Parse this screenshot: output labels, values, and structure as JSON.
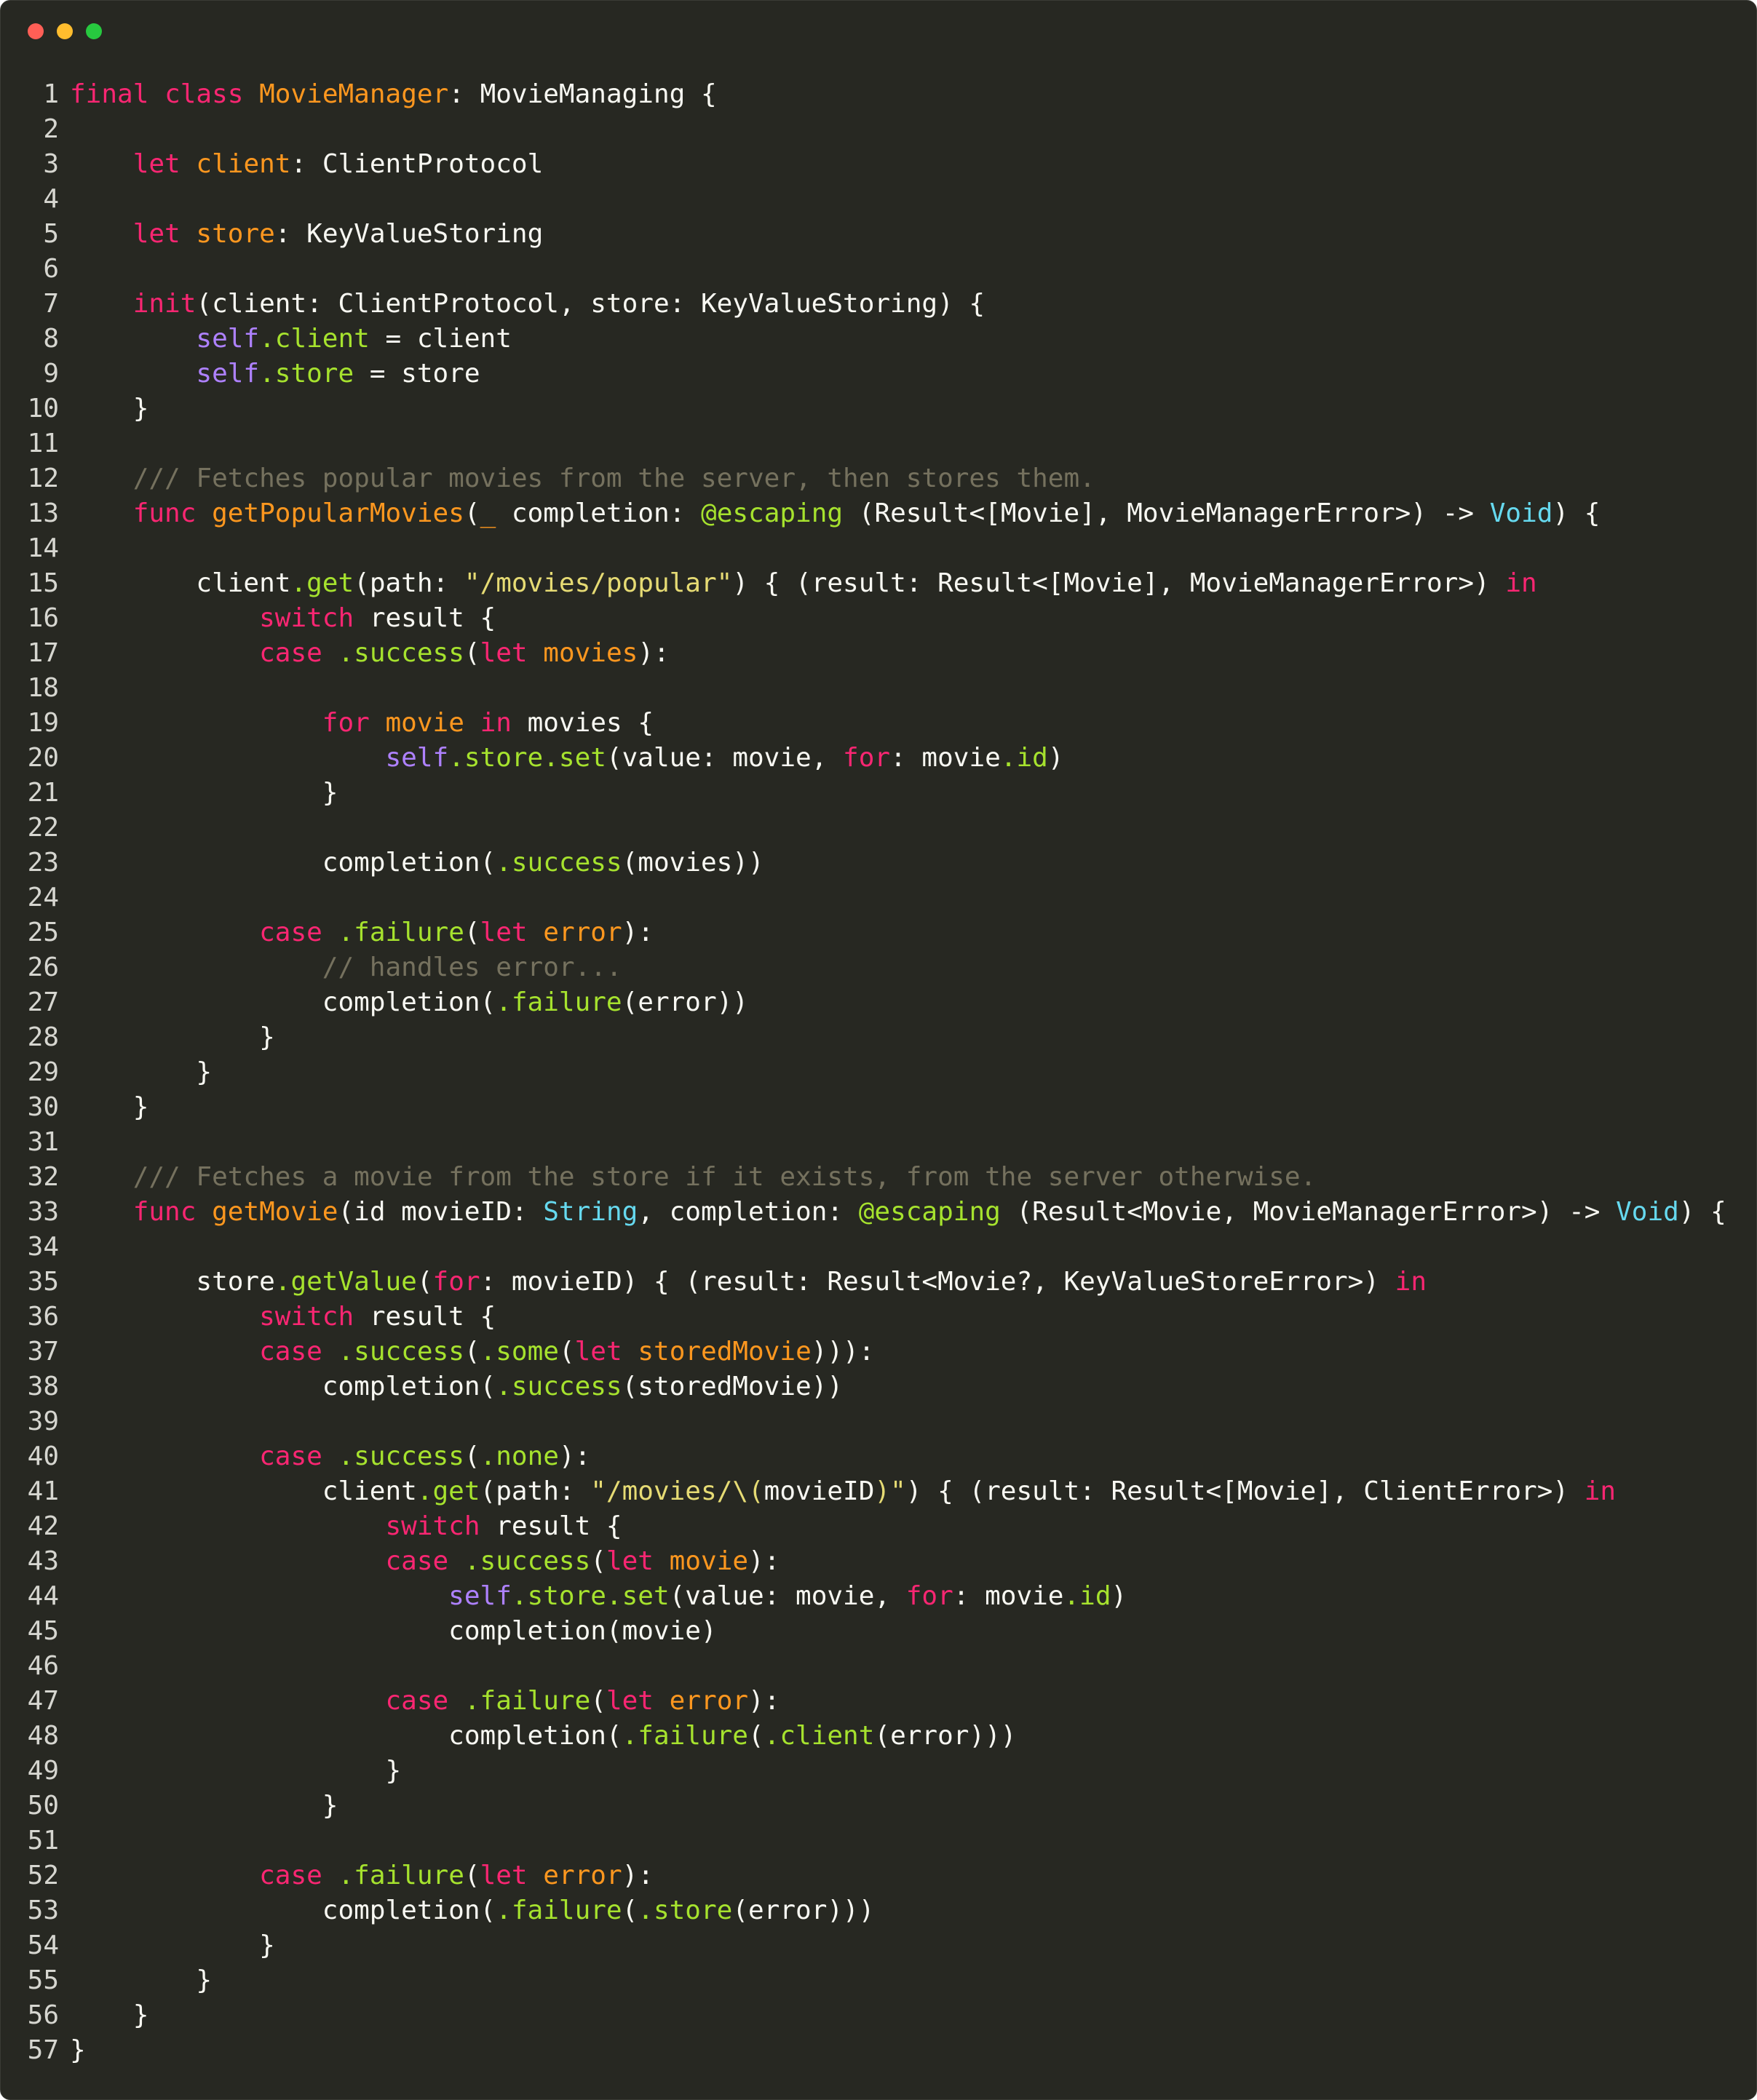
{
  "window": {
    "controls": [
      {
        "name": "close",
        "color": "#ff5f56"
      },
      {
        "name": "minimize",
        "color": "#ffbd2e"
      },
      {
        "name": "zoom",
        "color": "#27c93f"
      }
    ]
  },
  "theme": {
    "background": "#272822",
    "foreground": "#f8f8f2",
    "keyword": "#f92672",
    "declaration": "#fd971f",
    "member": "#a6e22e",
    "self": "#ae81ff",
    "type": "#66d9ef",
    "string": "#e6db74",
    "comment": "#75715e"
  },
  "code": {
    "language": "swift",
    "lines": [
      [
        [
          "k",
          "final"
        ],
        [
          "n",
          " "
        ],
        [
          "k",
          "class"
        ],
        [
          "n",
          " "
        ],
        [
          "t",
          "MovieManager"
        ],
        [
          "n",
          ": MovieManaging {"
        ]
      ],
      [],
      [
        [
          "n",
          "    "
        ],
        [
          "k",
          "let"
        ],
        [
          "n",
          " "
        ],
        [
          "t",
          "client"
        ],
        [
          "n",
          ": ClientProtocol"
        ]
      ],
      [],
      [
        [
          "n",
          "    "
        ],
        [
          "k",
          "let"
        ],
        [
          "n",
          " "
        ],
        [
          "t",
          "store"
        ],
        [
          "n",
          ": KeyValueStoring"
        ]
      ],
      [],
      [
        [
          "n",
          "    "
        ],
        [
          "k",
          "init"
        ],
        [
          "n",
          "(client: ClientProtocol, store: KeyValueStoring) {"
        ]
      ],
      [
        [
          "n",
          "        "
        ],
        [
          "p",
          "self"
        ],
        [
          "f",
          ".client"
        ],
        [
          "n",
          " = client"
        ]
      ],
      [
        [
          "n",
          "        "
        ],
        [
          "p",
          "self"
        ],
        [
          "f",
          ".store"
        ],
        [
          "n",
          " = store"
        ]
      ],
      [
        [
          "n",
          "    }"
        ]
      ],
      [],
      [
        [
          "n",
          "    "
        ],
        [
          "m",
          "/// Fetches popular movies from the server, then stores them."
        ]
      ],
      [
        [
          "n",
          "    "
        ],
        [
          "k",
          "func"
        ],
        [
          "n",
          " "
        ],
        [
          "t",
          "getPopularMovies"
        ],
        [
          "n",
          "("
        ],
        [
          "t",
          "_"
        ],
        [
          "n",
          " completion: "
        ],
        [
          "f",
          "@escaping"
        ],
        [
          "n",
          " (Result<[Movie], MovieManagerError>) -> "
        ],
        [
          "c",
          "Void"
        ],
        [
          "n",
          ") {"
        ]
      ],
      [],
      [
        [
          "n",
          "        client"
        ],
        [
          "f",
          ".get"
        ],
        [
          "n",
          "(path: "
        ],
        [
          "s",
          "\"/movies/popular\""
        ],
        [
          "n",
          ") { (result: Result<[Movie], MovieManagerError>) "
        ],
        [
          "k",
          "in"
        ]
      ],
      [
        [
          "n",
          "            "
        ],
        [
          "k",
          "switch"
        ],
        [
          "n",
          " result {"
        ]
      ],
      [
        [
          "n",
          "            "
        ],
        [
          "k",
          "case"
        ],
        [
          "n",
          " "
        ],
        [
          "f",
          ".success"
        ],
        [
          "n",
          "("
        ],
        [
          "k",
          "let"
        ],
        [
          "n",
          " "
        ],
        [
          "t",
          "movies"
        ],
        [
          "n",
          "):"
        ]
      ],
      [],
      [
        [
          "n",
          "                "
        ],
        [
          "k",
          "for"
        ],
        [
          "n",
          " "
        ],
        [
          "t",
          "movie"
        ],
        [
          "n",
          " "
        ],
        [
          "k",
          "in"
        ],
        [
          "n",
          " movies {"
        ]
      ],
      [
        [
          "n",
          "                    "
        ],
        [
          "p",
          "self"
        ],
        [
          "f",
          ".store.set"
        ],
        [
          "n",
          "(value: movie, "
        ],
        [
          "k",
          "for"
        ],
        [
          "n",
          ": movie"
        ],
        [
          "f",
          ".id"
        ],
        [
          "n",
          ")"
        ]
      ],
      [
        [
          "n",
          "                }"
        ]
      ],
      [],
      [
        [
          "n",
          "                completion("
        ],
        [
          "f",
          ".success"
        ],
        [
          "n",
          "(movies))"
        ]
      ],
      [],
      [
        [
          "n",
          "            "
        ],
        [
          "k",
          "case"
        ],
        [
          "n",
          " "
        ],
        [
          "f",
          ".failure"
        ],
        [
          "n",
          "("
        ],
        [
          "k",
          "let"
        ],
        [
          "n",
          " "
        ],
        [
          "t",
          "error"
        ],
        [
          "n",
          "):"
        ]
      ],
      [
        [
          "n",
          "                "
        ],
        [
          "m",
          "// handles error..."
        ]
      ],
      [
        [
          "n",
          "                completion("
        ],
        [
          "f",
          ".failure"
        ],
        [
          "n",
          "(error))"
        ]
      ],
      [
        [
          "n",
          "            }"
        ]
      ],
      [
        [
          "n",
          "        }"
        ]
      ],
      [
        [
          "n",
          "    }"
        ]
      ],
      [],
      [
        [
          "n",
          "    "
        ],
        [
          "m",
          "/// Fetches a movie from the store if it exists, from the server otherwise."
        ]
      ],
      [
        [
          "n",
          "    "
        ],
        [
          "k",
          "func"
        ],
        [
          "n",
          " "
        ],
        [
          "t",
          "getMovie"
        ],
        [
          "n",
          "(id movieID: "
        ],
        [
          "c",
          "String"
        ],
        [
          "n",
          ", completion: "
        ],
        [
          "f",
          "@escaping"
        ],
        [
          "n",
          " (Result<Movie, MovieManagerError>) -> "
        ],
        [
          "c",
          "Void"
        ],
        [
          "n",
          ") {"
        ]
      ],
      [],
      [
        [
          "n",
          "        store"
        ],
        [
          "f",
          ".getValue"
        ],
        [
          "n",
          "("
        ],
        [
          "k",
          "for"
        ],
        [
          "n",
          ": movieID) { (result: Result<Movie?, KeyValueStoreError>) "
        ],
        [
          "k",
          "in"
        ]
      ],
      [
        [
          "n",
          "            "
        ],
        [
          "k",
          "switch"
        ],
        [
          "n",
          " result {"
        ]
      ],
      [
        [
          "n",
          "            "
        ],
        [
          "k",
          "case"
        ],
        [
          "n",
          " "
        ],
        [
          "f",
          ".success"
        ],
        [
          "n",
          "("
        ],
        [
          "f",
          ".some"
        ],
        [
          "n",
          "("
        ],
        [
          "k",
          "let"
        ],
        [
          "n",
          " "
        ],
        [
          "t",
          "storedMovie"
        ],
        [
          "n",
          "))):"
        ]
      ],
      [
        [
          "n",
          "                completion("
        ],
        [
          "f",
          ".success"
        ],
        [
          "n",
          "(storedMovie))"
        ]
      ],
      [],
      [
        [
          "n",
          "            "
        ],
        [
          "k",
          "case"
        ],
        [
          "n",
          " "
        ],
        [
          "f",
          ".success"
        ],
        [
          "n",
          "("
        ],
        [
          "f",
          ".none"
        ],
        [
          "n",
          "):"
        ]
      ],
      [
        [
          "n",
          "                client"
        ],
        [
          "f",
          ".get"
        ],
        [
          "n",
          "(path: "
        ],
        [
          "s",
          "\"/movies/\\("
        ],
        [
          "n",
          "movieID"
        ],
        [
          "s",
          ")\""
        ],
        [
          "n",
          ") { (result: Result<[Movie], ClientError>) "
        ],
        [
          "k",
          "in"
        ]
      ],
      [
        [
          "n",
          "                    "
        ],
        [
          "k",
          "switch"
        ],
        [
          "n",
          " result {"
        ]
      ],
      [
        [
          "n",
          "                    "
        ],
        [
          "k",
          "case"
        ],
        [
          "n",
          " "
        ],
        [
          "f",
          ".success"
        ],
        [
          "n",
          "("
        ],
        [
          "k",
          "let"
        ],
        [
          "n",
          " "
        ],
        [
          "t",
          "movie"
        ],
        [
          "n",
          "):"
        ]
      ],
      [
        [
          "n",
          "                        "
        ],
        [
          "p",
          "self"
        ],
        [
          "f",
          ".store.set"
        ],
        [
          "n",
          "(value: movie, "
        ],
        [
          "k",
          "for"
        ],
        [
          "n",
          ": movie"
        ],
        [
          "f",
          ".id"
        ],
        [
          "n",
          ")"
        ]
      ],
      [
        [
          "n",
          "                        completion(movie)"
        ]
      ],
      [],
      [
        [
          "n",
          "                    "
        ],
        [
          "k",
          "case"
        ],
        [
          "n",
          " "
        ],
        [
          "f",
          ".failure"
        ],
        [
          "n",
          "("
        ],
        [
          "k",
          "let"
        ],
        [
          "n",
          " "
        ],
        [
          "t",
          "error"
        ],
        [
          "n",
          "):"
        ]
      ],
      [
        [
          "n",
          "                        completion("
        ],
        [
          "f",
          ".failure"
        ],
        [
          "n",
          "("
        ],
        [
          "f",
          ".client"
        ],
        [
          "n",
          "(error)))"
        ]
      ],
      [
        [
          "n",
          "                    }"
        ]
      ],
      [
        [
          "n",
          "                }"
        ]
      ],
      [],
      [
        [
          "n",
          "            "
        ],
        [
          "k",
          "case"
        ],
        [
          "n",
          " "
        ],
        [
          "f",
          ".failure"
        ],
        [
          "n",
          "("
        ],
        [
          "k",
          "let"
        ],
        [
          "n",
          " "
        ],
        [
          "t",
          "error"
        ],
        [
          "n",
          "):"
        ]
      ],
      [
        [
          "n",
          "                completion("
        ],
        [
          "f",
          ".failure"
        ],
        [
          "n",
          "("
        ],
        [
          "f",
          ".store"
        ],
        [
          "n",
          "(error)))"
        ]
      ],
      [
        [
          "n",
          "            }"
        ]
      ],
      [
        [
          "n",
          "        }"
        ]
      ],
      [
        [
          "n",
          "    }"
        ]
      ],
      [
        [
          "n",
          "}"
        ]
      ]
    ]
  }
}
